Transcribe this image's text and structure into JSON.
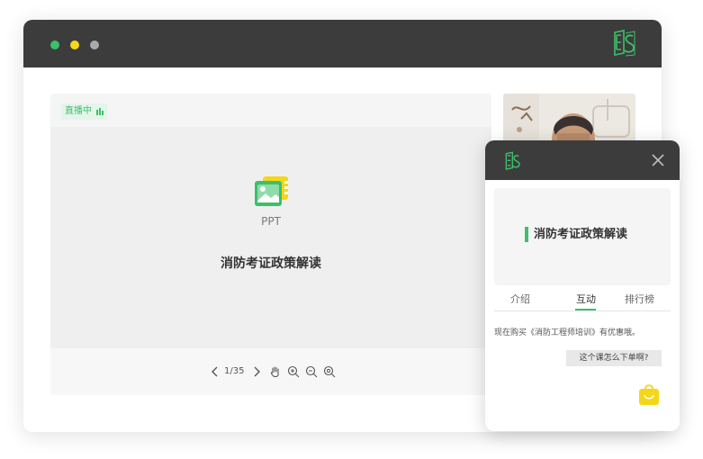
{
  "window": {
    "traffic_lights": [
      "green",
      "yellow",
      "gray"
    ],
    "logo": "es-logo-icon"
  },
  "stage": {
    "live_badge": "直播中",
    "slide_type_label": "PPT",
    "slide_title": "消防考证政策解读",
    "page_indicator": "1/35",
    "controls": [
      "chevron-left-icon",
      "chevron-right-icon",
      "hand-icon",
      "zoom-in-icon",
      "zoom-out-icon",
      "zoom-reset-icon"
    ]
  },
  "panel": {
    "course_title": "消防考证政策解读",
    "tabs": [
      {
        "label": "介绍",
        "active": false
      },
      {
        "label": "互动",
        "active": true
      },
      {
        "label": "排行榜",
        "active": false
      }
    ],
    "messages": [
      "现在购买《消防工程师培训》有优惠哦。"
    ],
    "reply": "这个课怎么下单啊?",
    "shop_icon": "shopping-bag-icon"
  },
  "colors": {
    "accent": "#3dbf6b",
    "titlebar": "#3c3c3c",
    "yellow": "#f4d71a"
  }
}
